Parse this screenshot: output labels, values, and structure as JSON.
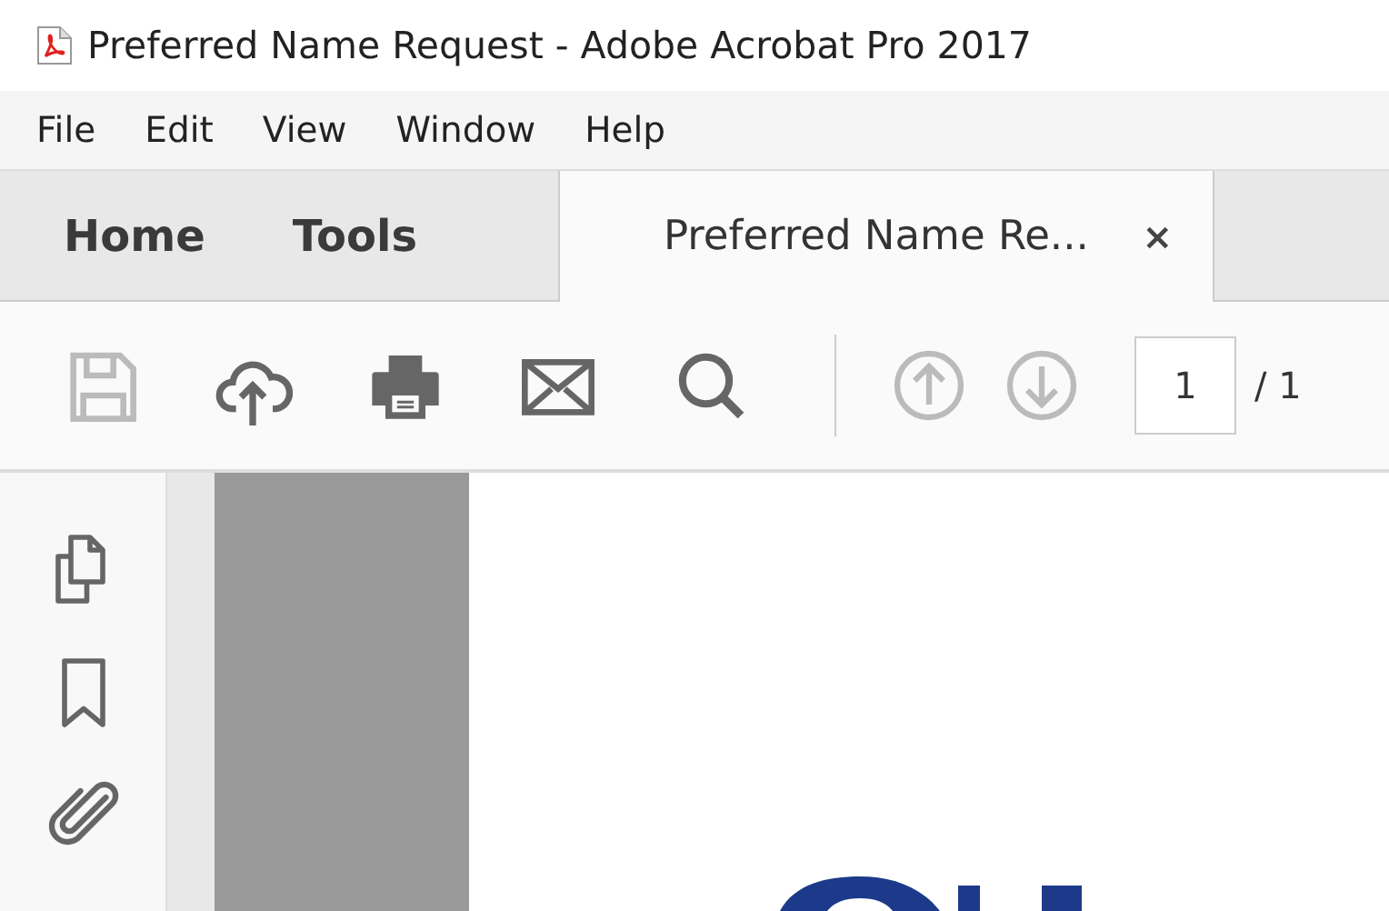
{
  "window": {
    "title": "Preferred Name Request - Adobe Acrobat Pro 2017"
  },
  "menu": [
    "File",
    "Edit",
    "View",
    "Window",
    "Help"
  ],
  "nav_tabs": [
    {
      "label": "Home",
      "selected": false
    },
    {
      "label": "Tools",
      "selected": false
    }
  ],
  "document_tab": {
    "label": "Preferred Name Re...",
    "close": "×",
    "selected": true
  },
  "toolbar": [
    {
      "kind": "save",
      "disabled": true
    },
    {
      "kind": "upload",
      "disabled": false
    },
    {
      "kind": "print",
      "disabled": false
    },
    {
      "kind": "mail",
      "disabled": false
    },
    {
      "kind": "search",
      "disabled": false
    },
    {
      "kind": "separator",
      "disabled": false
    },
    {
      "kind": "prev",
      "disabled": true
    },
    {
      "kind": "next",
      "disabled": true
    }
  ],
  "page_field": {
    "value": "1",
    "total": "/ 1"
  },
  "side_panel": [
    {
      "kind": "pages"
    },
    {
      "kind": "bookmark"
    },
    {
      "kind": "attachment"
    }
  ]
}
